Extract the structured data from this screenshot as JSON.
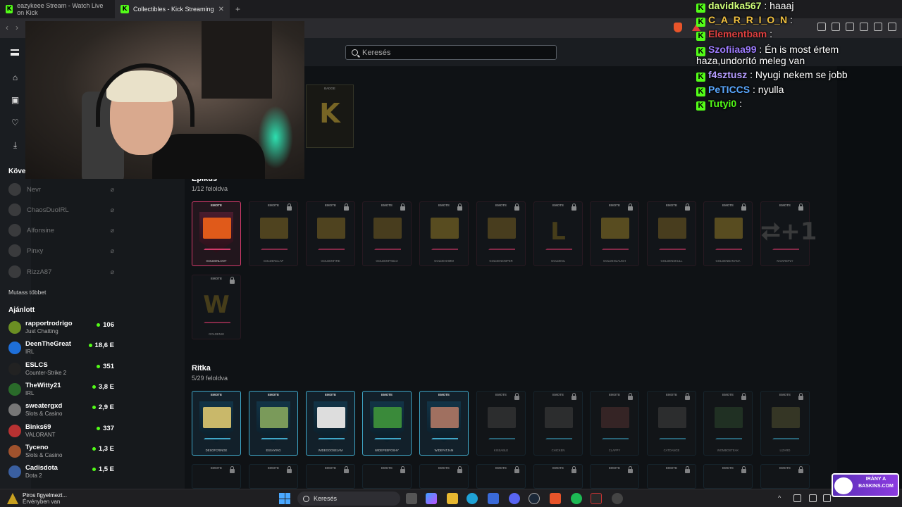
{
  "tabs": [
    {
      "title": "eazykeee Stream - Watch Live on Kick"
    },
    {
      "title": "Collectibles - Kick Streaming"
    }
  ],
  "header": {
    "search_placeholder": "Keresés"
  },
  "sidebar": {
    "following_title": "Követ",
    "following": [
      {
        "name": "Nevr"
      },
      {
        "name": "ChaosDuoIRL"
      },
      {
        "name": "Alfonsine"
      },
      {
        "name": "Pinxy"
      },
      {
        "name": "RizzA87"
      }
    ],
    "show_more": "Mutass többet",
    "recommended_title": "Ajánlott",
    "recommended": [
      {
        "name": "rapportrodrigo",
        "category": "Just Chatting",
        "viewers": "106",
        "color": "#6b8e23"
      },
      {
        "name": "DeenTheGreat",
        "category": "IRL",
        "viewers": "18,6 E",
        "color": "#1e6fd9"
      },
      {
        "name": "ESLCS",
        "category": "Counter-Strike 2",
        "viewers": "351",
        "color": "#222222"
      },
      {
        "name": "TheWitty21",
        "category": "IRL",
        "viewers": "3,8 E",
        "color": "#2a6b2a"
      },
      {
        "name": "sweatergxd",
        "category": "Slots & Casino",
        "viewers": "2,9 E",
        "color": "#777777"
      },
      {
        "name": "Binks69",
        "category": "VALORANT",
        "viewers": "337",
        "color": "#b83232"
      },
      {
        "name": "Tyceno",
        "category": "Slots & Casino",
        "viewers": "1,3 E",
        "color": "#a0522d"
      },
      {
        "name": "Cadisdota",
        "category": "Dota 2",
        "viewers": "1,5 E",
        "color": "#3a5fa0"
      }
    ]
  },
  "sections": {
    "epic": {
      "title": "Epikus",
      "progress": "1/12 feloldva"
    },
    "rare": {
      "title": "Ritka",
      "progress": "5/29 feloldva"
    }
  },
  "card_tag": "EMOTE",
  "epic_cards": [
    {
      "name": "GOLDENLOOT",
      "unlocked": true,
      "color": "#e05a1a"
    },
    {
      "name": "GOLDENCLAP",
      "unlocked": false,
      "color": "#7a6426"
    },
    {
      "name": "GOLDENFIRE",
      "unlocked": false,
      "color": "#7a6426"
    },
    {
      "name": "GOLDENPABLO",
      "unlocked": false,
      "color": "#6e5a24"
    },
    {
      "name": "GOLDENHMM",
      "unlocked": false,
      "color": "#8a7428"
    },
    {
      "name": "GOLDENSNIPER",
      "unlocked": false,
      "color": "#6e5a24"
    },
    {
      "name": "GOLDENL",
      "unlocked": false,
      "letter": "L",
      "color": "#6b5a1e"
    },
    {
      "name": "GOLDENLAUGH",
      "unlocked": false,
      "color": "#8a7428"
    },
    {
      "name": "GOLDENSKULL",
      "unlocked": false,
      "color": "#6e5a24"
    },
    {
      "name": "GOLDENBANANA",
      "unlocked": false,
      "color": "#8a7428"
    },
    {
      "name": "KICKREPLY",
      "unlocked": false,
      "letter": "⮂+1",
      "color": "#555555"
    },
    {
      "name": "GOLDENW",
      "unlocked": false,
      "letter": "W",
      "color": "#6b5a1e"
    }
  ],
  "rare_cards": [
    {
      "name": "DESOFCRINGE",
      "unlocked": true,
      "color": "#c9b86a"
    },
    {
      "name": "ESSAYING",
      "unlocked": true,
      "color": "#7a9a5a"
    },
    {
      "name": "WIDEGOOSEJAM",
      "unlocked": true,
      "color": "#dddddd"
    },
    {
      "name": "WIDEPEEPOSHY",
      "unlocked": true,
      "color": "#3a8a3a"
    },
    {
      "name": "WIDEFATJAM",
      "unlocked": true,
      "color": "#a07060"
    },
    {
      "name": "KISSABLE",
      "unlocked": false,
      "color": "#444444"
    },
    {
      "name": "CHICKEN",
      "unlocked": false,
      "color": "#444444"
    },
    {
      "name": "CLAPPY",
      "unlocked": false,
      "color": "#553333"
    },
    {
      "name": "CATDANCE",
      "unlocked": false,
      "color": "#444444"
    },
    {
      "name": "WOMBOSTEAK",
      "unlocked": false,
      "color": "#2f4a2f"
    },
    {
      "name": "LIZARD",
      "unlocked": false,
      "color": "#555533"
    }
  ],
  "badge_preview": {
    "tag": "BADGE",
    "letter": "K"
  },
  "chat": [
    {
      "user": "davidka567",
      "text": " : haaaj",
      "color": "#cfff7a"
    },
    {
      "user": "C_A_R_R_I_O_N",
      "text": " : ",
      "color": "#f0c040"
    },
    {
      "user": "Elementbam",
      "text": " : ",
      "color": "#e04040"
    },
    {
      "user": "Szofiiaa99",
      "text": " : Én is most értem",
      "color": "#9d7cff"
    },
    {
      "user": "",
      "text": "haza,undorító meleg van",
      "color": "#ffffff"
    },
    {
      "user": "f4sztusz",
      "text": " : Nyugi nekem se jobb",
      "color": "#b49cff"
    },
    {
      "user": "PeTICCS",
      "text": " : nyulla",
      "color": "#5aa8ff"
    },
    {
      "user": "Tutyi0",
      "text": " : ",
      "color": "#53fc18"
    }
  ],
  "taskbar": {
    "notif_title": "Piros figyelmezt...",
    "notif_sub": "Érvényben van",
    "search_label": "Keresés"
  },
  "ad": {
    "text": "IRÁNY A\nBASKINS.COM"
  }
}
